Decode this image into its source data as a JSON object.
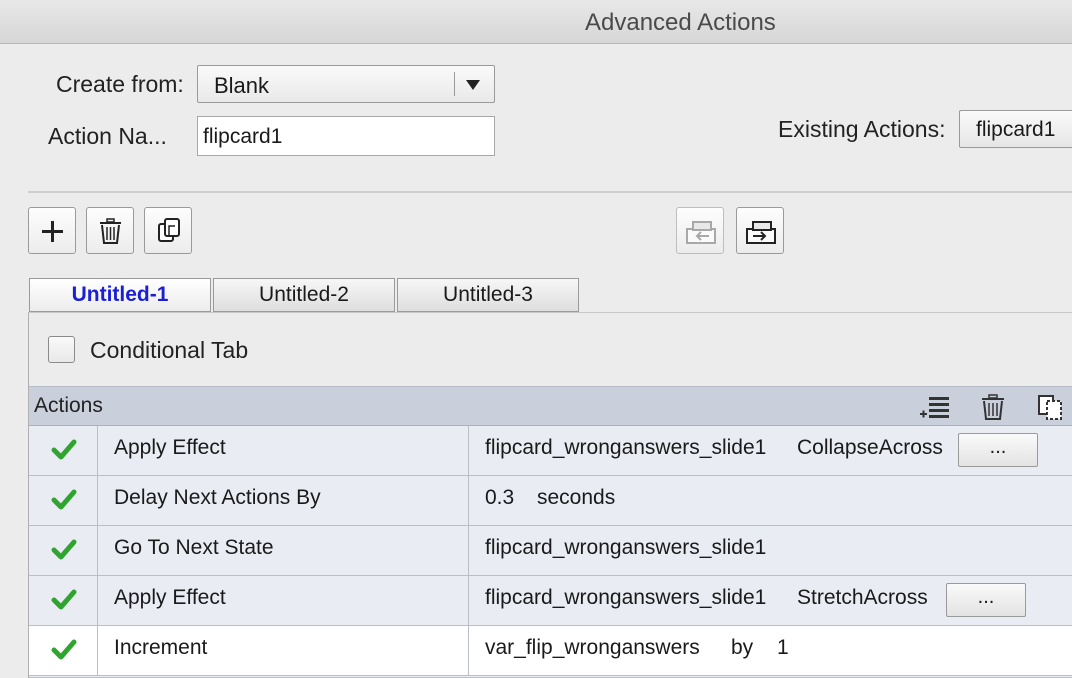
{
  "window": {
    "title": "Advanced Actions"
  },
  "form": {
    "create_from_label": "Create from:",
    "create_from_value": "Blank",
    "action_name_label": "Action Na...",
    "action_name_value": "flipcard1",
    "existing_actions_label": "Existing Actions:",
    "existing_actions_value": "flipcard1"
  },
  "toolbar": {
    "icons": [
      "plus-icon",
      "trash-icon",
      "duplicate-icon",
      "import-icon",
      "export-icon"
    ]
  },
  "tabs": [
    {
      "label": "Untitled-1",
      "active": true
    },
    {
      "label": "Untitled-2",
      "active": false
    },
    {
      "label": "Untitled-3",
      "active": false
    }
  ],
  "conditional_tab": {
    "label": "Conditional Tab",
    "checked": false
  },
  "actions_table": {
    "header": "Actions",
    "header_icons": [
      "insert-row-icon",
      "trash-icon",
      "copy-icon"
    ],
    "rows": [
      {
        "action": "Apply Effect",
        "target": "flipcard_wronganswers_slide1",
        "detail": "CollapseAcross",
        "more": "..."
      },
      {
        "action": "Delay Next Actions By",
        "target": "0.3",
        "detail": "seconds"
      },
      {
        "action": "Go To Next State",
        "target": "flipcard_wronganswers_slide1"
      },
      {
        "action": "Apply Effect",
        "target": "flipcard_wronganswers_slide1",
        "detail": "StretchAcross",
        "more": "..."
      },
      {
        "action": "Increment",
        "target": "var_flip_wronganswers",
        "detail": "by",
        "extra": "1"
      }
    ]
  },
  "colors": {
    "active_tab_text": "#1a1fd4",
    "check_green": "#2fa52f",
    "header_bg": "#c9d0dc",
    "row_bg": "#e9ecf3"
  }
}
